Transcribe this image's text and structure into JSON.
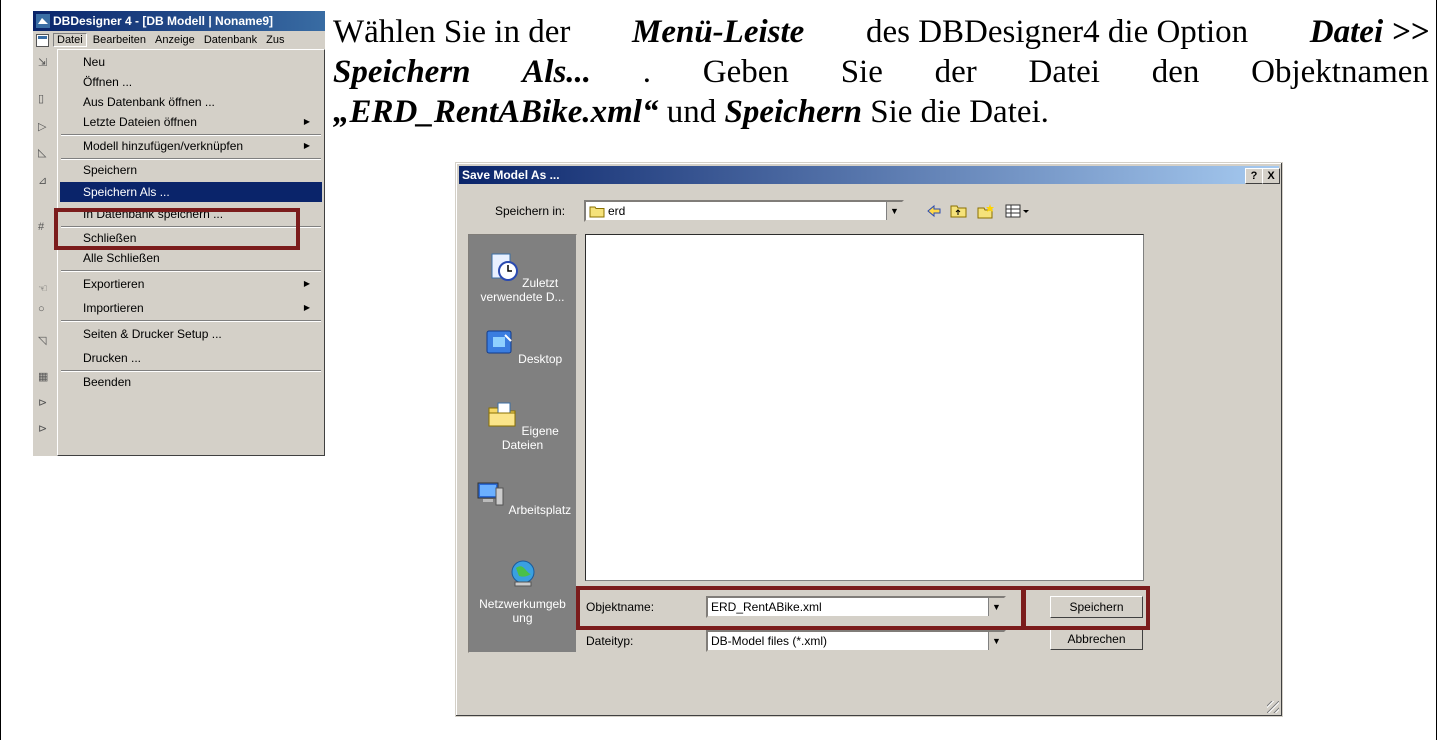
{
  "app": {
    "title": "DBDesigner 4 - [DB Modell | Noname9]",
    "menubar": [
      "Datei",
      "Bearbeiten",
      "Anzeige",
      "Datenbank",
      "Zus"
    ],
    "menu_items": [
      {
        "label": "Neu"
      },
      {
        "label": "Öffnen ..."
      },
      {
        "label": "Aus Datenbank öffnen ..."
      },
      {
        "label": "Letzte Dateien öffnen",
        "submenu": true
      },
      {
        "label": "Modell hinzufügen/verknüpfen",
        "submenu": true
      },
      {
        "label": "Speichern"
      },
      {
        "label": "Speichern Als ...",
        "selected": true
      },
      {
        "label": "In Datenbank speichern ..."
      },
      {
        "label": "Schließen"
      },
      {
        "label": "Alle Schließen"
      },
      {
        "label": "Exportieren",
        "submenu": true
      },
      {
        "label": "Importieren",
        "submenu": true
      },
      {
        "label": "Seiten & Drucker Setup ..."
      },
      {
        "label": "Drucken ..."
      },
      {
        "label": "Beenden"
      }
    ]
  },
  "instruction": {
    "l1_a": "Wählen Sie in der",
    "l1_b": "Menü-Leiste",
    "l1_c": "des DBDesigner4 die Option",
    "l1_d": "Datei >>",
    "l2_a": "Speichern",
    "l2_b": "Als...",
    "l2_c": ".",
    "l2_d": "Geben",
    "l2_e": "Sie",
    "l2_f": "der",
    "l2_g": "Datei",
    "l2_h": "den",
    "l2_i": "Objektnamen",
    "l3_a": "„ERD_RentABike.xml“",
    "l3_b": "und",
    "l3_c": "Speichern",
    "l3_d": "Sie die Datei."
  },
  "dialog": {
    "title": "Save Model As ...",
    "help_btn": "?",
    "close_btn": "X",
    "lookin_label": "Speichern in:",
    "lookin_value": "erd",
    "places": [
      "Zuletzt verwendete D...",
      "Desktop",
      "Eigene Dateien",
      "Arbeitsplatz",
      "Netzwerkumgeb ung"
    ],
    "filename_label": "Objektname:",
    "filename_value": "ERD_RentABike.xml",
    "filetype_label": "Dateityp:",
    "filetype_value": "DB-Model files (*.xml)",
    "save_btn": "Speichern",
    "cancel_btn": "Abbrechen"
  },
  "colors": {
    "highlight_border": "#7b1c1c",
    "title_blue": "#0a246a",
    "menu_bg": "#d4d0c8"
  }
}
